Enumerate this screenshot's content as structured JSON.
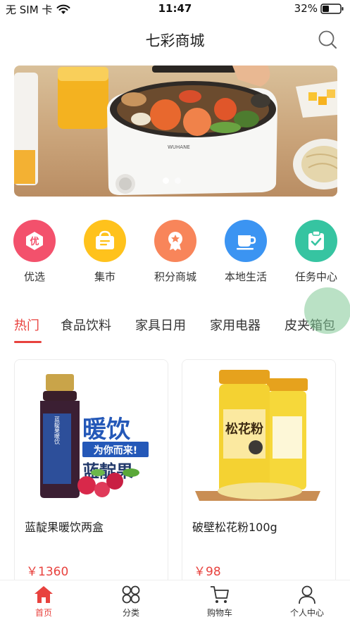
{
  "status_bar": {
    "carrier": "无 SIM 卡",
    "time": "11:47",
    "battery": "32%"
  },
  "header": {
    "title": "七彩商城"
  },
  "banner": {
    "brand_text": "WUHANE",
    "page_count": 2,
    "active_index": 0
  },
  "categories": [
    {
      "label": "优选",
      "icon": "youxuan-badge-icon",
      "color": "#f3516c",
      "glyph": "优"
    },
    {
      "label": "集市",
      "icon": "basket-icon",
      "color": "#ffc21c"
    },
    {
      "label": "积分商城",
      "icon": "medal-icon",
      "color": "#f8855a"
    },
    {
      "label": "本地生活",
      "icon": "coffee-cup-icon",
      "color": "#3b94f2"
    },
    {
      "label": "任务中心",
      "icon": "clipboard-check-icon",
      "color": "#36c4a1"
    }
  ],
  "tabs": [
    "热门",
    "食品饮料",
    "家具日用",
    "家用电器",
    "皮夹箱包"
  ],
  "products": [
    {
      "name": "蓝靛果暖饮两盒",
      "price": "￥1360",
      "image_texts": {
        "headline": "暖饮",
        "slogan": "为你而来!",
        "product": "蓝靛果",
        "bottle_label": "蓝靛果暖饮"
      }
    },
    {
      "name": "破壁松花粉100g",
      "price": "￥98",
      "image_texts": {
        "jar_label": "松花粉"
      }
    }
  ],
  "bottom_nav": [
    {
      "label": "首页",
      "icon": "home-icon",
      "active": true
    },
    {
      "label": "分类",
      "icon": "category-grid-icon",
      "active": false
    },
    {
      "label": "购物车",
      "icon": "cart-icon",
      "active": false
    },
    {
      "label": "个人中心",
      "icon": "person-icon",
      "active": false
    }
  ],
  "colors": {
    "accent": "#e8423e",
    "text": "#222222"
  }
}
